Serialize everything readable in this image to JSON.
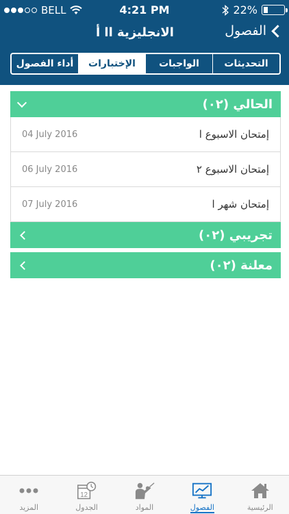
{
  "status_bar": {
    "carrier": "BELL",
    "time": "4:21 PM",
    "battery": "22%",
    "battery_level": 0.22
  },
  "nav": {
    "back_label": "الفصول",
    "title": "الانجليزية اا أ"
  },
  "segments": [
    {
      "label": "التحديثات",
      "active": false
    },
    {
      "label": "الواجبات",
      "active": false
    },
    {
      "label": "الإختبارات",
      "active": true
    },
    {
      "label": "أداء الفصول",
      "active": false
    }
  ],
  "sections": [
    {
      "title": "الحالي (٠٢)",
      "expanded": true,
      "items": [
        {
          "title": "إمتحان الاسبوع ا",
          "date": "04 July 2016"
        },
        {
          "title": "إمتحان الاسبوع ٢",
          "date": "06 July 2016"
        },
        {
          "title": "إمتحان شهر ا",
          "date": "07 July 2016"
        }
      ]
    },
    {
      "title": "تجريبي (٠٢)",
      "expanded": false
    },
    {
      "title": "معلنة (٠٢)",
      "expanded": false
    }
  ],
  "tabbar": {
    "tabs": [
      {
        "label": "الرئيسية",
        "icon": "home-icon"
      },
      {
        "label": "الفصول",
        "icon": "classes-chart-icon",
        "active": true
      },
      {
        "label": "المواد",
        "icon": "teacher-icon"
      },
      {
        "label": "الجدول",
        "icon": "calendar-clock-icon",
        "day": "12"
      },
      {
        "label": "المزيد",
        "icon": "more-dots-icon"
      }
    ]
  },
  "colors": {
    "header": "#10527f",
    "accent_green": "#4fcf98",
    "tab_active": "#1673c6"
  }
}
